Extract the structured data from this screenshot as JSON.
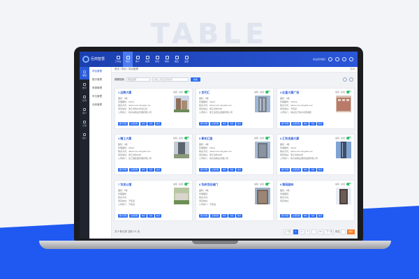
{
  "hero_text": "TABLE",
  "app": {
    "logo_text": "巨商智慧"
  },
  "nav": [
    {
      "label": "工作台",
      "active": false
    },
    {
      "label": "项目",
      "active": true
    },
    {
      "label": "客户",
      "active": false
    },
    {
      "label": "房源",
      "active": false
    },
    {
      "label": "合同",
      "active": false
    },
    {
      "label": "财务",
      "active": false
    },
    {
      "label": "报表",
      "active": false
    },
    {
      "label": "设置",
      "active": false
    }
  ],
  "top_right": {
    "user_label": "欢迎您管理员"
  },
  "rail": [
    {
      "label": "项目",
      "active": true
    },
    {
      "label": "楼宇",
      "active": false
    },
    {
      "label": "房间",
      "active": false
    },
    {
      "label": "客户",
      "active": false
    },
    {
      "label": "记录",
      "active": false
    },
    {
      "label": "统计",
      "active": false
    }
  ],
  "submenu": [
    {
      "label": "项目管理",
      "active": true
    },
    {
      "label": "楼宇管理",
      "active": false
    },
    {
      "label": "房源管理",
      "active": false
    },
    {
      "label": "车位管理",
      "active": false
    },
    {
      "label": "仓库管理",
      "active": false
    }
  ],
  "breadcrumb": {
    "text": "首页 / 项目 / 项目管理",
    "tab": "关闭"
  },
  "filter": {
    "label": "模糊搜索",
    "select_value": "项目名称",
    "placeholder": "请输入项目名称搜索",
    "button": "搜索"
  },
  "cards": [
    {
      "num": "1",
      "name": "达辉大厦",
      "area": "面积：8栋",
      "manager": "管理面积：165㎡",
      "mail": "联系方式：tablemusic.dingtalk.com",
      "address": "项目地址：浙江省杭州市滨江区",
      "intro": "公司简介：杭州某物业管理有限公司"
    },
    {
      "num": "2",
      "name": "世代汇",
      "area": "面积：8栋",
      "manager": "管理面积：190㎡",
      "mail": "联系方式：tablemusic.dingtalk.com",
      "address": "项目地址：浙江省杭州市",
      "intro": "公司简介：浙江某置业发展有限公司"
    },
    {
      "num": "3",
      "name": "红星大厦广场",
      "area": "面积：8栋",
      "manager": "管理面积：1260㎡",
      "mail": "联系方式：tablemusic.dingtalk.com",
      "address": "项目地址：不知道",
      "intro": "公司简介：地址位于杭州市西湖区"
    },
    {
      "num": "4",
      "name": "精工大厦",
      "area": "面积：5栋",
      "manager": "管理面积：180㎡",
      "mail": "联系方式：tablemusic.dingtalk.com",
      "address": "项目地址：浙江省杭州市",
      "intro": "公司简介：某工程集团管理有限公司"
    },
    {
      "num": "5",
      "name": "青年汇园",
      "area": "面积：8栋",
      "manager": "管理面积：180㎡",
      "mail": "联系方式：tablemusic.dingtalk.com",
      "address": "项目地址：浙江省杭州市",
      "intro": "公司简介：杭州某物业管理公司"
    },
    {
      "num": "6",
      "name": "汇利发展大厦",
      "area": "面积：8栋",
      "manager": "管理面积：210㎡",
      "mail": "联系方式：tablemusic.dingtalk.com",
      "address": "项目地址：浙江省杭州市",
      "intro": "公司简介：杭州某物业服务集团有限公司"
    },
    {
      "num": "7",
      "name": "华发公馆",
      "area": "面积：8栋",
      "manager": "管理面积：",
      "mail": "联系方式：",
      "address": "项目地址：不知道",
      "intro": "公司简介：不知道"
    },
    {
      "num": "8",
      "name": "华府世纪城门",
      "area": "面积：8栋",
      "manager": "管理面积：",
      "mail": "联系方式：",
      "address": "项目地址：",
      "intro": "公司简介：不知道"
    },
    {
      "num": "9",
      "name": "翠苑园林",
      "area": "面积：8栋",
      "manager": "管理面积：",
      "mail": "联系方式：",
      "address": "项目地址：",
      "intro": ""
    }
  ],
  "card_labels": {
    "edit": "编辑",
    "status": "启用"
  },
  "card_buttons": [
    "楼宇管理",
    "房源管理",
    "车位",
    "仓库",
    "统计"
  ],
  "footer": {
    "total": "共 9 条记录  当前 1/1 页",
    "pages": [
      "上一页",
      "1",
      "2",
      "3",
      "...",
      "10",
      "下一页"
    ],
    "jump_label": "前往",
    "go": "确定"
  },
  "colors": {
    "accent": "#2b6ef5",
    "header": "#1b3fae",
    "floor": "#1f59f2",
    "orange": "#ff7a1a",
    "toggle_on": "#32c36c"
  }
}
